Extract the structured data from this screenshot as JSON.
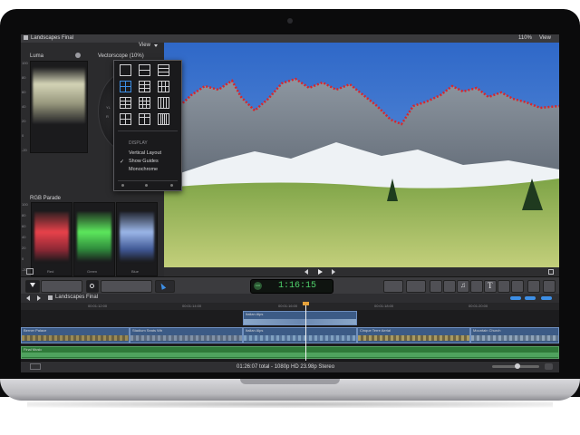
{
  "app": {
    "project_title": "Landscapes Final",
    "zoom": "110%",
    "view_label": "View",
    "viewer_view_label": "View"
  },
  "scopes": {
    "luma_title": "Luma",
    "vectorscope_title": "Vectorscope (10%)",
    "vectorscope_labels": [
      "YL",
      "R"
    ],
    "luma_ticks": [
      "100",
      "80",
      "60",
      "40",
      "20",
      "0",
      "-20"
    ],
    "rgb_title": "RGB Parade",
    "rgb_ticks": [
      "100",
      "80",
      "60",
      "40",
      "20",
      "0",
      "-20"
    ],
    "channels": [
      "Red",
      "Green",
      "Blue"
    ]
  },
  "view_menu": {
    "section_label": "DISPLAY",
    "items": [
      {
        "label": "Vertical Layout",
        "checked": false
      },
      {
        "label": "Show Guides",
        "checked": true
      },
      {
        "label": "Monochrome",
        "checked": false
      }
    ],
    "checkmark": "✓"
  },
  "timecode": "1:16:15",
  "timecode_small": "100",
  "timeline": {
    "title": "Landscapes Final",
    "ruler_ticks": [
      "00:01:12:00",
      "00:01:14:00",
      "00:01:16:00",
      "00:01:18:00",
      "00:01:20:00"
    ],
    "connected_clip": "Italian Alps",
    "clips": [
      "Berner Palace",
      "Stadium Seats Wb",
      "Italian Alps",
      "Cinque Terre Aerial",
      "Mountain Church"
    ],
    "audio_clip": "Final Music"
  },
  "status": {
    "summary": "01:26:07 total - 1080p HD 23.98p Stereo"
  },
  "colors": {
    "accent": "#3d8fe6",
    "clip_blue": "#3c5b86",
    "audio_green": "#2f7a3a",
    "timecode_green": "#4fd16b"
  }
}
